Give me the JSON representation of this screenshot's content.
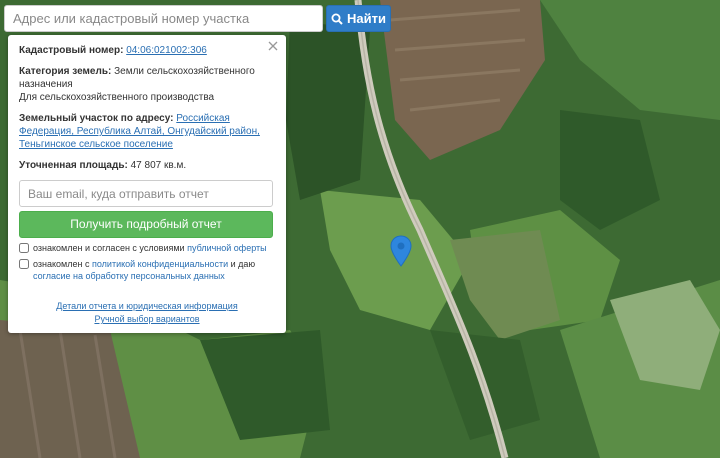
{
  "search": {
    "placeholder": "Адрес или кадастровый номер участка",
    "button_label": "Найти",
    "button_icon": "search-icon"
  },
  "panel": {
    "cadastral_label": "Кадастровый номер:",
    "cadastral_value": "04:06:021002:306",
    "category_label": "Категория земель:",
    "category_value": "Земли сельскохозяйственного назначения",
    "category_use": "Для сельскохозяйственного производства",
    "address_label": "Земельный участок по адресу:",
    "address_value": "Российская Федерация, Республика Алтай, Онгудайский район, Теньгинское сельское поселение",
    "area_label": "Уточненная площадь:",
    "area_value": "47 807 кв.м.",
    "email_placeholder": "Ваш email, куда отправить отчет",
    "report_button": "Получить подробный отчет",
    "consent1_prefix": "ознакомлен и согласен с условиями",
    "consent1_link": "публичной оферты",
    "consent2_prefix": "ознакомлен с",
    "consent2_link1": "политикой конфиденциальности",
    "consent2_middle": "и даю",
    "consent2_link2": "согласие на обработку персональных данных",
    "details_link": "Детали отчета и юридическая информация",
    "manual_link": "Ручной выбор вариантов",
    "close_icon": "close-icon"
  },
  "map": {
    "marker_icon": "map-pin-icon",
    "colors": {
      "forest": "#2f5a2a",
      "meadow": "#6a9a4a",
      "road": "#c9c5b8",
      "field": "#7b6a55",
      "pin": "#2e86de"
    }
  }
}
